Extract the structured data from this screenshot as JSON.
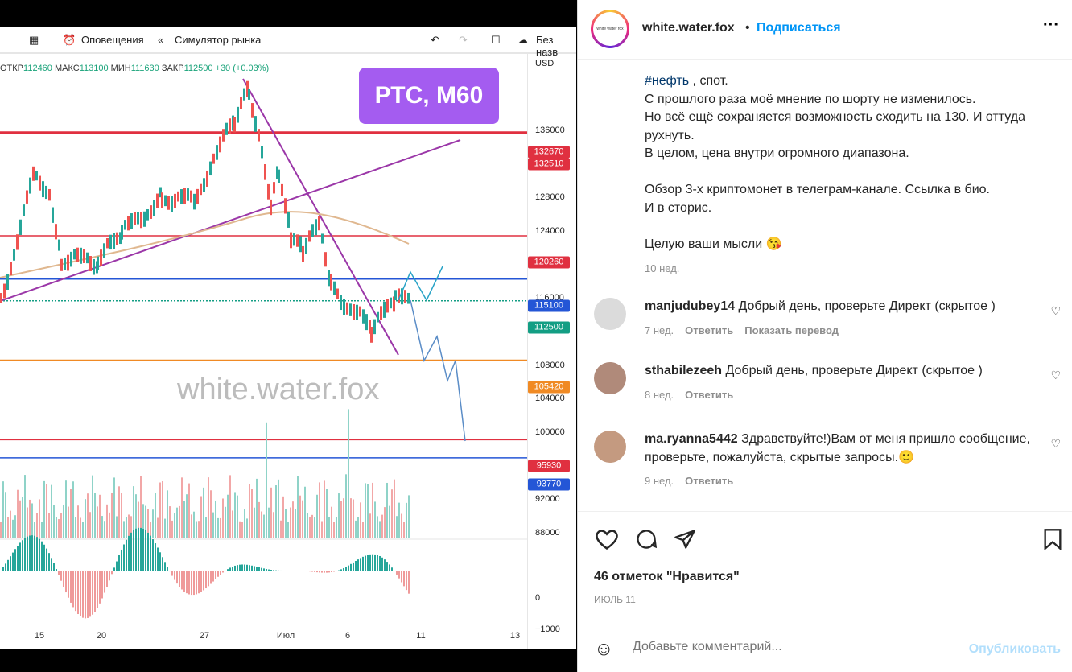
{
  "toolbar": {
    "alerts": "Оповещения",
    "replay": "Симулятор рынка",
    "save": "Без назв"
  },
  "ohlc": {
    "o_label": "ОТКР",
    "o": "112460",
    "h_label": "МАКС",
    "h": "113100",
    "l_label": "МИН",
    "l": "111630",
    "c_label": "ЗАКР",
    "c": "112500",
    "change": "+30 (+0.03%)"
  },
  "chart": {
    "currency": "USD",
    "badge": "РТС, М60",
    "watermark": "white.water.fox",
    "ticks": [
      "136000",
      "128000",
      "124000",
      "116000",
      "108000",
      "104000",
      "100000",
      "92000",
      "88000"
    ],
    "osc_ticks": [
      "0",
      "−1000"
    ],
    "price_labels": [
      {
        "value": "132670",
        "color": "#e03040"
      },
      {
        "value": "132510",
        "color": "#e03040"
      },
      {
        "value": "120260",
        "color": "#e03040"
      },
      {
        "value": "115100",
        "color": "#2456d6"
      },
      {
        "value": "112500",
        "color": "#139e84"
      },
      {
        "value": "105420",
        "color": "#f08a24"
      },
      {
        "value": "95930",
        "color": "#e03040"
      },
      {
        "value": "93770",
        "color": "#2456d6"
      }
    ],
    "x_labels": [
      "15",
      "20",
      "27",
      "Июл",
      "6",
      "11",
      "13"
    ]
  },
  "post": {
    "username": "white.water.fox",
    "follow": "Подписаться",
    "hashtag": "#нефть",
    "caption_first": " , спот.",
    "caption_lines": [
      "С прошлого раза моё мнение по шорту не изменилось.",
      "Но всё ещё сохраняется возможность сходить на 130. И оттуда рухнуть.",
      "В целом, цена внутри огромного диапазона.",
      "",
      "Обзор 3-х криптомонет в телеграм-канале. Ссылка в био.",
      "И в сторис.",
      "",
      "Целую ваши мысли 😘"
    ],
    "time": "10 нед.",
    "likes": "46 отметок \"Нравится\"",
    "date": "ИЮЛЬ 11",
    "comment_placeholder": "Добавьте комментарий...",
    "publish": "Опубликовать"
  },
  "comments": [
    {
      "user": "manjudubey14",
      "text": "Добрый день, проверьте Директ (скрытое )",
      "time": "7 нед.",
      "reply": "Ответить",
      "translate": "Показать перевод"
    },
    {
      "user": "sthabilezeeh",
      "text": "Добрый день, проверьте Директ (скрытое )",
      "time": "8 нед.",
      "reply": "Ответить"
    },
    {
      "user": "ma.ryanna5442",
      "text": "Здравствуйте!)Вам от меня пришло сообщение, проверьте, пожалуйста, скрытые запросы.🙂",
      "time": "9 нед.",
      "reply": "Ответить"
    }
  ]
}
